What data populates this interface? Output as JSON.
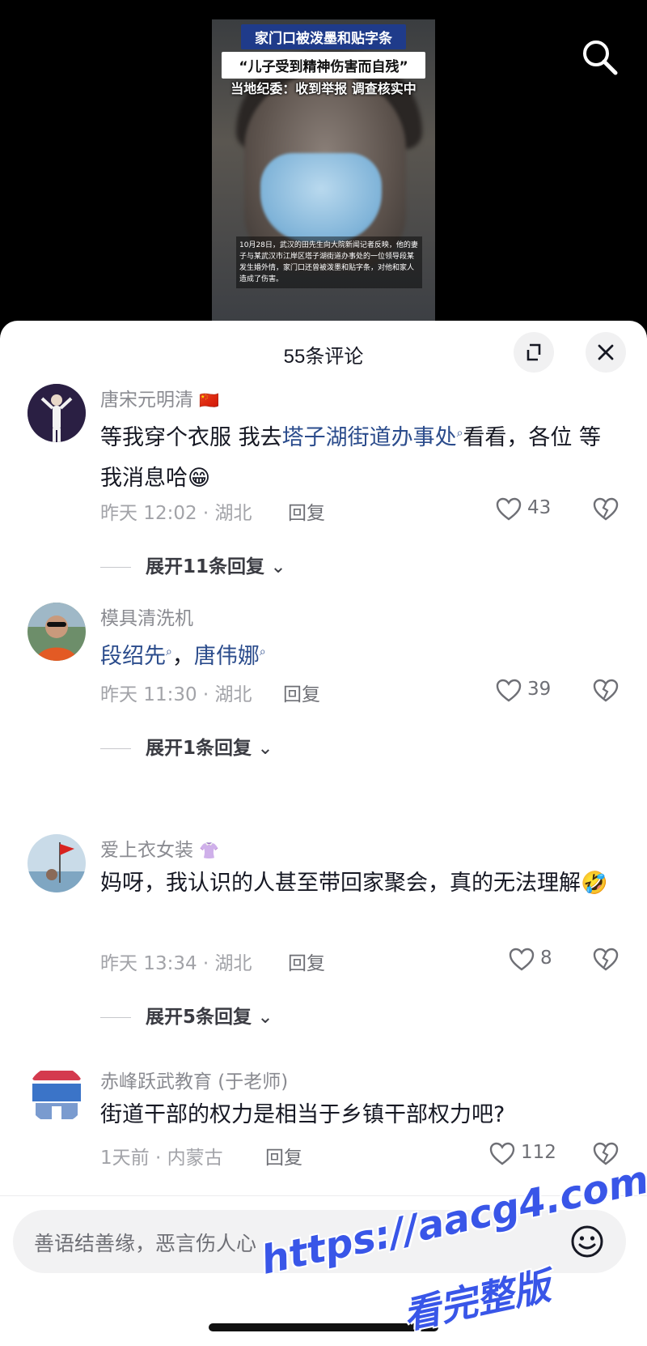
{
  "video": {
    "banner1": "家门口被泼墨和贴字条",
    "banner2": "“儿子受到精神伤害而自残”",
    "banner3": "当地纪委：收到举报 调查核实中",
    "caption": "10月28日，武汉的田先生向大院新闻记者反映，他的妻子与某武汉市江岸区塔子湖街道办事处的一位领导段某发生婚外情，家门口还曾被泼墨和贴字条，对他和家人造成了伤害。"
  },
  "sheet": {
    "title": "55条评论"
  },
  "comments": [
    {
      "username": "唐宋元明清",
      "flag": "🇨🇳",
      "text_before": "等我穿个衣服 我去",
      "link": "塔子湖街道办事处",
      "text_after": "看看，各位 等我消息哈",
      "emoji": "😁",
      "meta": "昨天 12:02 · 湖北",
      "reply": "回复",
      "likes": "43",
      "expand": "展开11条回复"
    },
    {
      "username": "模具清洗机",
      "link1": "段绍先",
      "sep": "，",
      "link2": "唐伟娜",
      "meta": "昨天 11:30 · 湖北",
      "reply": "回复",
      "likes": "39",
      "expand": "展开1条回复"
    },
    {
      "username": "爱上衣女装",
      "badge": "👚",
      "text": "妈呀，我认识的人甚至带回家聚会，真的无法理解",
      "emoji": "🤣",
      "meta": "昨天 13:34 · 湖北",
      "reply": "回复",
      "likes": "8",
      "expand": "展开5条回复"
    },
    {
      "username": "赤峰跃武教育 (于老师)",
      "text": "街道干部的权力是相当于乡镇干部权力吧?",
      "meta": "1天前 · 内蒙古",
      "reply": "回复",
      "likes": "112"
    }
  ],
  "input": {
    "placeholder": "善语结善缘，恶言伤人心"
  },
  "watermark": {
    "line1": "https://aacg4.com",
    "line2": "看完整版"
  },
  "colors": {
    "link": "#2b4c8c",
    "sheet_bg": "#ffffff",
    "backdrop": "#000000",
    "watermark": "#3956e8"
  }
}
